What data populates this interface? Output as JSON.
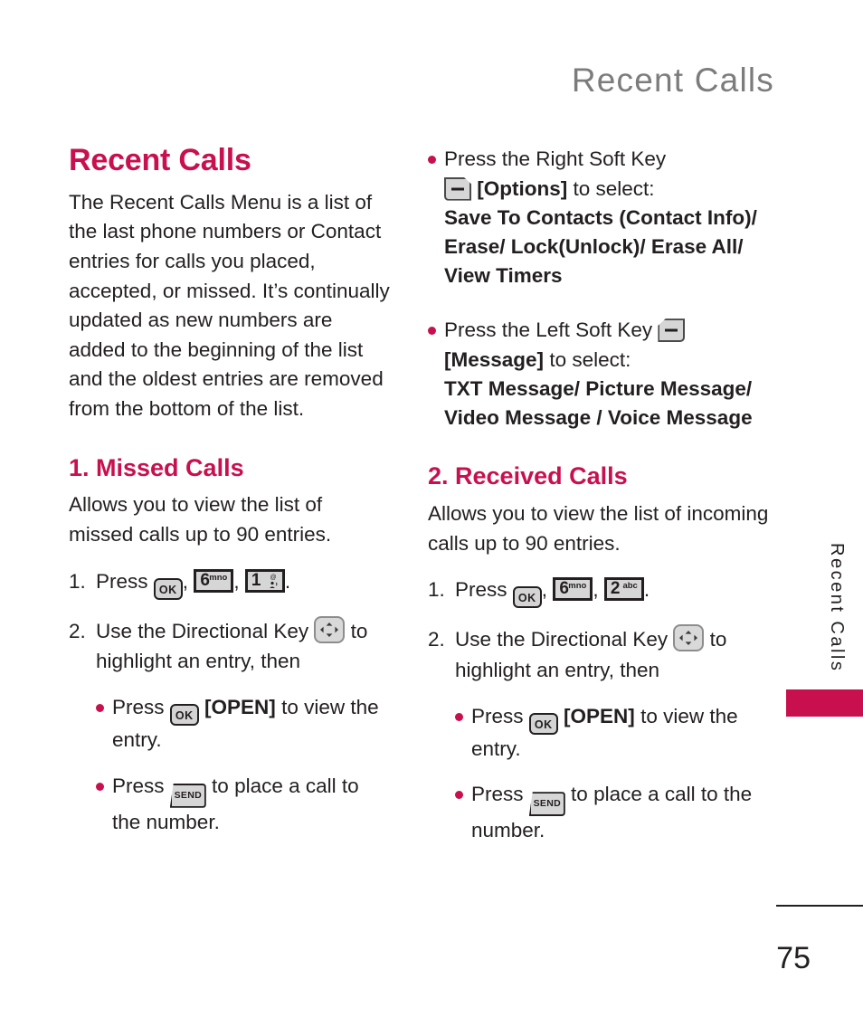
{
  "running_header": "Recent Calls",
  "page_number": "75",
  "side_tab_label": "Recent Calls",
  "left_column": {
    "section_title": "Recent Calls",
    "intro_paragraph": "The Recent Calls Menu is a list of the last phone numbers or Contact entries for calls you placed, accepted, or missed. It’s continually updated as new numbers are added to the beginning of the list and the oldest entries are removed from the bottom of the list.",
    "sub_title": "1. Missed Calls",
    "sub_description": "Allows you to view the list of missed calls up to 90 entries.",
    "step1": {
      "number": "1.",
      "press_label": "Press",
      "keys": [
        {
          "icon": "ok-key",
          "label": "OK"
        },
        {
          "icon": "num-key-6",
          "digit": "6",
          "sub": "mno"
        },
        {
          "icon": "num-key-1",
          "digit": "1",
          "sub": "voicemail"
        }
      ],
      "separator": ",",
      "terminator": "."
    },
    "step2": {
      "number": "2.",
      "text_before": "Use the Directional Key",
      "icon": "directional-key",
      "text_after": "to highlight an entry, then"
    },
    "bullets": [
      {
        "press_label": "Press",
        "icon": "ok-key",
        "icon_label": "OK",
        "bracket_label": "[OPEN]",
        "text_after": "to view the entry."
      },
      {
        "press_label": "Press",
        "icon": "send-key",
        "icon_label": "SEND",
        "bracket_label": "",
        "text_after": "to place a call to the number."
      }
    ]
  },
  "right_column": {
    "bullets_top": [
      {
        "text_before": "Press the Right Soft Key",
        "icon": "right-soft-key",
        "bracket_label": "[Options]",
        "text_after": "to select:",
        "options": "Save To Contacts (Contact Info)/ Erase/ Lock(Unlock)/ Erase All/ View Timers"
      },
      {
        "text_before": "Press the Left Soft Key",
        "icon": "left-soft-key",
        "bracket_label": "[Message]",
        "text_after": "to select:",
        "options": "TXT Message/ Picture Message/ Video Message / Voice Message"
      }
    ],
    "sub_title": "2. Received Calls",
    "sub_description": "Allows you to view the list of incoming calls up to 90 entries.",
    "step1": {
      "number": "1.",
      "press_label": "Press",
      "keys": [
        {
          "icon": "ok-key",
          "label": "OK"
        },
        {
          "icon": "num-key-6",
          "digit": "6",
          "sub": "mno"
        },
        {
          "icon": "num-key-2",
          "digit": "2",
          "sub": "abc"
        }
      ],
      "separator": ",",
      "terminator": "."
    },
    "step2": {
      "number": "2.",
      "text_before": "Use the Directional Key",
      "icon": "directional-key",
      "text_after": "to highlight an entry, then"
    },
    "bullets": [
      {
        "press_label": "Press",
        "icon": "ok-key",
        "icon_label": "OK",
        "bracket_label": "[OPEN]",
        "text_after": "to view the entry."
      },
      {
        "press_label": "Press",
        "icon": "send-key",
        "icon_label": "SEND",
        "bracket_label": "",
        "text_after": "to place a call to the number."
      }
    ]
  },
  "colors": {
    "accent": "#c8104e",
    "header_gray": "#7c7c7c",
    "body_text": "#231f20",
    "key_fill": "#d6d6d6"
  }
}
